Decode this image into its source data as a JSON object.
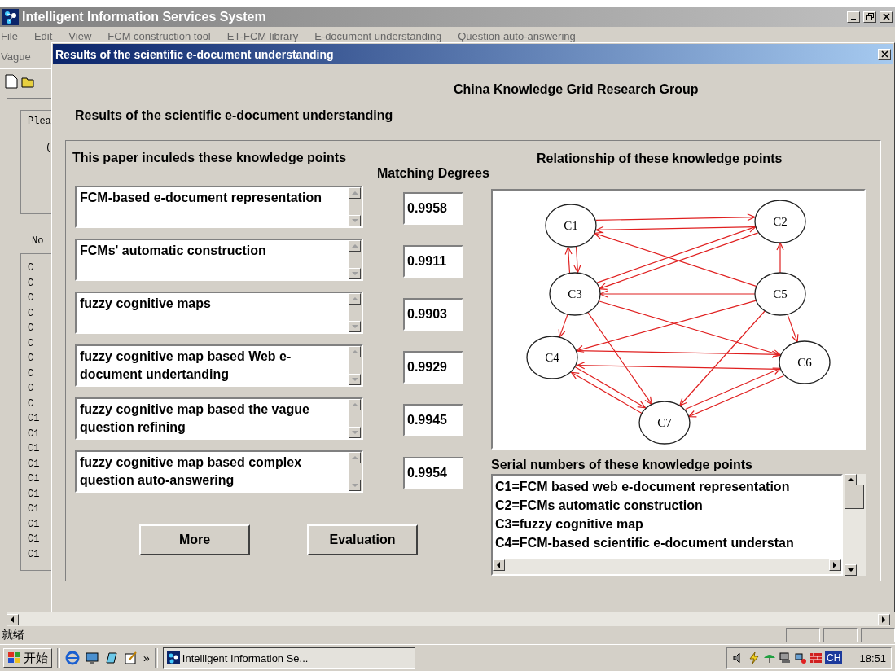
{
  "window": {
    "title": "Intelligent Information Services System"
  },
  "menu": [
    "File",
    "Edit",
    "View",
    "FCM construction tool",
    "ET-FCM library",
    "E-document understanding",
    "Question auto-answering"
  ],
  "menu_row_2": [
    "Vague"
  ],
  "left_pane": {
    "prompt": "Plea",
    "prompt_2": "(",
    "list_label": "No",
    "list_items": [
      "C",
      "C",
      "C",
      "C",
      "C",
      "C",
      "C",
      "C",
      "C",
      "C",
      "C1",
      "C1",
      "C1",
      "C1",
      "C1",
      "C1",
      "C1",
      "C1",
      "C1",
      "C1"
    ]
  },
  "dialog": {
    "title": "Results of the scientific e-document understanding",
    "group": "China Knowledge Grid Research Group",
    "heading": "Results of the scientific e-document understanding",
    "points_label": "This paper inculeds these knowledge points",
    "degrees_label": "Matching Degrees",
    "points": [
      {
        "text": "FCM-based e-document representation",
        "degree": "0.9958"
      },
      {
        "text": "FCMs' automatic construction",
        "degree": "0.9911"
      },
      {
        "text": "fuzzy cognitive maps",
        "degree": "0.9903"
      },
      {
        "text": "fuzzy cognitive map based Web e-document undertanding",
        "degree": "0.9929"
      },
      {
        "text": "fuzzy cognitive map based the vague question refining",
        "degree": "0.9945"
      },
      {
        "text": "fuzzy cognitive map based complex question auto-answering",
        "degree": "0.9954"
      }
    ],
    "graph_label": "Relationship of these knowledge points",
    "nodes": [
      "C1",
      "C2",
      "C3",
      "C4",
      "C5",
      "C6",
      "C7"
    ],
    "serial_label": "Serial numbers of these knowledge points",
    "serials": [
      "C1=FCM based web e-document representation",
      "C2=FCMs automatic construction",
      "C3=fuzzy cognitive map",
      "C4=FCM-based scientific e-document understan"
    ],
    "buttons": [
      "More",
      "Evaluation"
    ]
  },
  "status_bar": {
    "text": "就绪"
  },
  "taskbar": {
    "start": "开始",
    "more": "»",
    "task": "Intelligent Information Se...",
    "language": "CH",
    "time": "18:51"
  }
}
